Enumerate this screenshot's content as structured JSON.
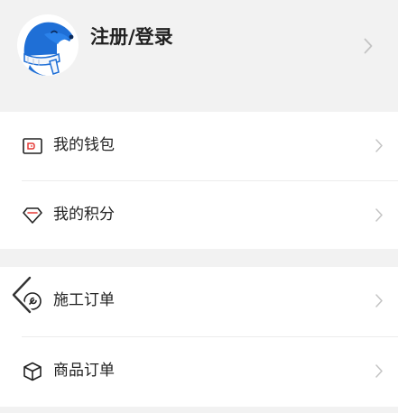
{
  "header": {
    "login_label": "注册/登录"
  },
  "menu_group_1": {
    "items": [
      {
        "label": "我的钱包",
        "icon": "wallet-icon"
      },
      {
        "label": "我的积分",
        "icon": "diamond-icon"
      }
    ]
  },
  "menu_group_2": {
    "items": [
      {
        "label": "施工订单",
        "icon": "wrench-icon"
      },
      {
        "label": "商品订单",
        "icon": "cube-icon"
      }
    ]
  },
  "colors": {
    "background": "#f2f2f2",
    "card": "#ffffff",
    "text": "#222222",
    "chevron": "#c4c4c4",
    "wallet_accent": "#e53935",
    "mascot_blue": "#1f6fd6"
  }
}
